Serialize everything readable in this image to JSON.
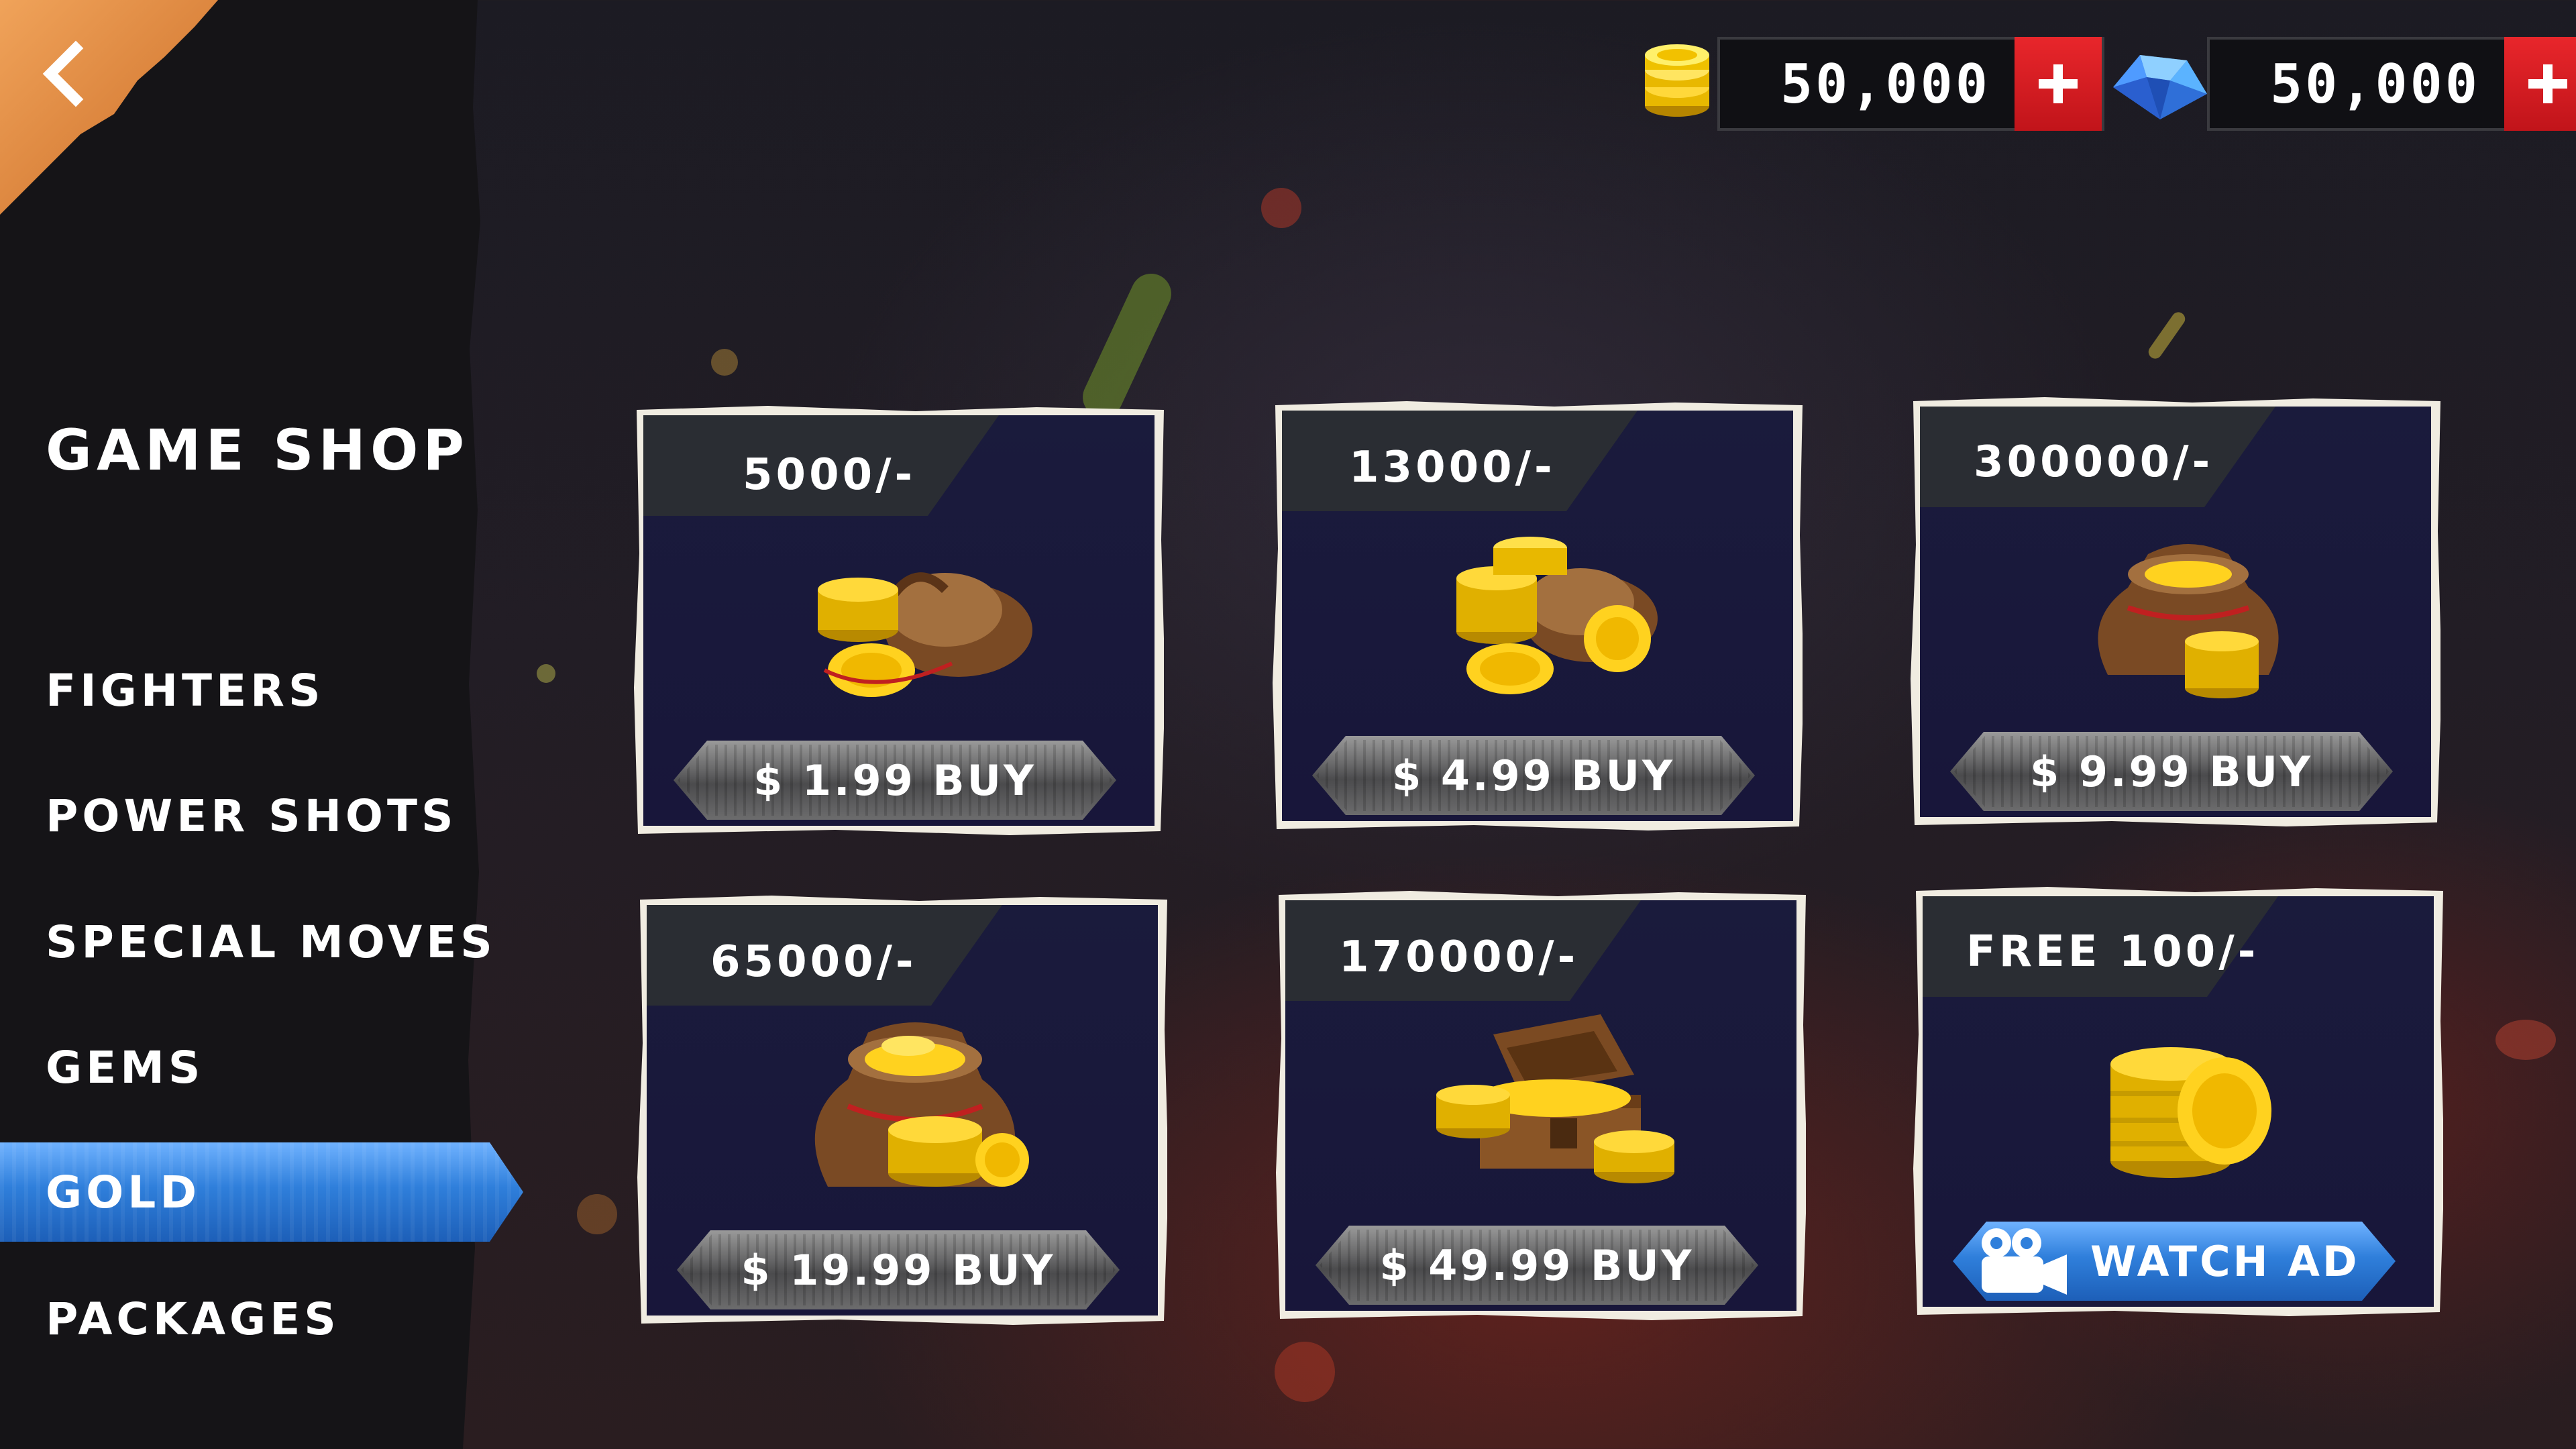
{
  "currencies": {
    "gold": {
      "value": "50,000",
      "icon": "gold-coins-icon",
      "plus": "+"
    },
    "gems": {
      "value": "50,000",
      "icon": "blue-gem-icon",
      "plus": "+"
    }
  },
  "sidebar": {
    "title": "GAME SHOP",
    "items": [
      {
        "label": "FIGHTERS",
        "active": false
      },
      {
        "label": "POWER SHOTS",
        "active": false
      },
      {
        "label": "SPECIAL MOVES",
        "active": false
      },
      {
        "label": "GEMS",
        "active": false
      },
      {
        "label": "GOLD",
        "active": true
      },
      {
        "label": "PACKAGES",
        "active": false
      }
    ]
  },
  "products": [
    {
      "amount": "5000/-",
      "button": "$ 1.99  BUY",
      "image": "small-coin-bag"
    },
    {
      "amount": "13000/-",
      "button": "$ 4.99  BUY",
      "image": "coin-bag-with-stacks"
    },
    {
      "amount": "300000/-",
      "button": "$ 9.99  BUY",
      "image": "open-coin-sack"
    },
    {
      "amount": "65000/-",
      "button": "$ 19.99  BUY",
      "image": "overflowing-coin-sack"
    },
    {
      "amount": "170000/-",
      "button": "$ 49.99  BUY",
      "image": "treasure-chest"
    },
    {
      "amount": "FREE 100/-",
      "button": "WATCH AD",
      "image": "coin-stack",
      "is_ad": true
    }
  ],
  "colors": {
    "accent_blue": "#2f7fdb",
    "plus_red": "#d11a1f",
    "back_orange": "#e08a40",
    "card_bg": "#1a1b3c"
  }
}
